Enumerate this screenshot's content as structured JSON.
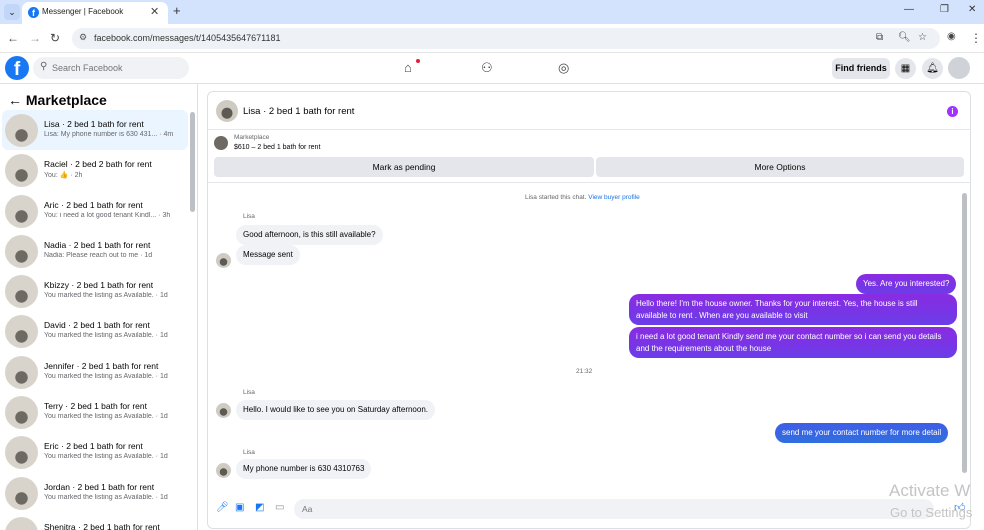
{
  "browser": {
    "tab_title": "Messenger | Facebook",
    "tab_close": "✕",
    "new_tab": "+",
    "url": "facebook.com/messages/t/1405435647671181",
    "window_controls": [
      "—",
      "❐",
      "✕"
    ]
  },
  "header": {
    "search_placeholder": "Search Facebook",
    "find_friends_label": "Find friends",
    "nav_icons": [
      "home-icon",
      "friends-icon",
      "groups-icon"
    ]
  },
  "sidebar": {
    "title": "Marketplace",
    "conversations": [
      {
        "name": "Lisa · 2 bed 1 bath for rent",
        "preview": "Lisa: My phone number is 630 431... · 4m"
      },
      {
        "name": "Raciel · 2 bed 2 bath for rent",
        "preview": "You: 👍 · 2h"
      },
      {
        "name": "Aric · 2 bed 1 bath for rent",
        "preview": "You: i need a lot good tenant Kindl... · 3h"
      },
      {
        "name": "Nadia · 2 bed 1 bath for rent",
        "preview": "Nadia: Please reach out to me · 1d"
      },
      {
        "name": "Kbizzy · 2 bed 1 bath for rent",
        "preview": "You marked the listing as Available. · 1d"
      },
      {
        "name": "David · 2 bed 1 bath for rent",
        "preview": "You marked the listing as Available. · 1d"
      },
      {
        "name": "Jennifer · 2 bed 1 bath for rent",
        "preview": "You marked the listing as Available. · 1d"
      },
      {
        "name": "Terry · 2 bed 1 bath for rent",
        "preview": "You marked the listing as Available. · 1d"
      },
      {
        "name": "Eric · 2 bed 1 bath for rent",
        "preview": "You marked the listing as Available. · 1d"
      },
      {
        "name": "Jordan · 2 bed 1 bath for rent",
        "preview": "You marked the listing as Available. · 1d"
      },
      {
        "name": "Shenitra · 2 bed 1 bath for rent",
        "preview": ""
      }
    ]
  },
  "chat": {
    "title": "Lisa · 2 bed 1 bath for rent",
    "listing_type": "Marketplace",
    "listing_price": "$610 – 2 bed 1 bath for rent",
    "mark_pending": "Mark as pending",
    "more_options": "More Options",
    "started_text": "Lisa started this chat.",
    "view_profile": "View buyer profile",
    "sender_name": "Lisa",
    "msg1": "Good afternoon, is this still available?",
    "msg2": "Message sent",
    "out1": "Yes. Are you interested?",
    "out2": "Hello there! I'm the house owner. Thanks for your interest. Yes, the house is still available to rent . When are you available to visit",
    "out3": "i need a lot good tenant Kindly send me your contact number so i can send you details and the requirements about the house",
    "time": "21:32",
    "msg3": "Hello. I would like to see you on Saturday afternoon.",
    "out4": "send me your contact number for more detail",
    "msg4": "My phone number is 630 4310763",
    "composer_placeholder": "Aa"
  },
  "watermark": {
    "line1": "Activate W",
    "line2": "Go to Settings"
  }
}
